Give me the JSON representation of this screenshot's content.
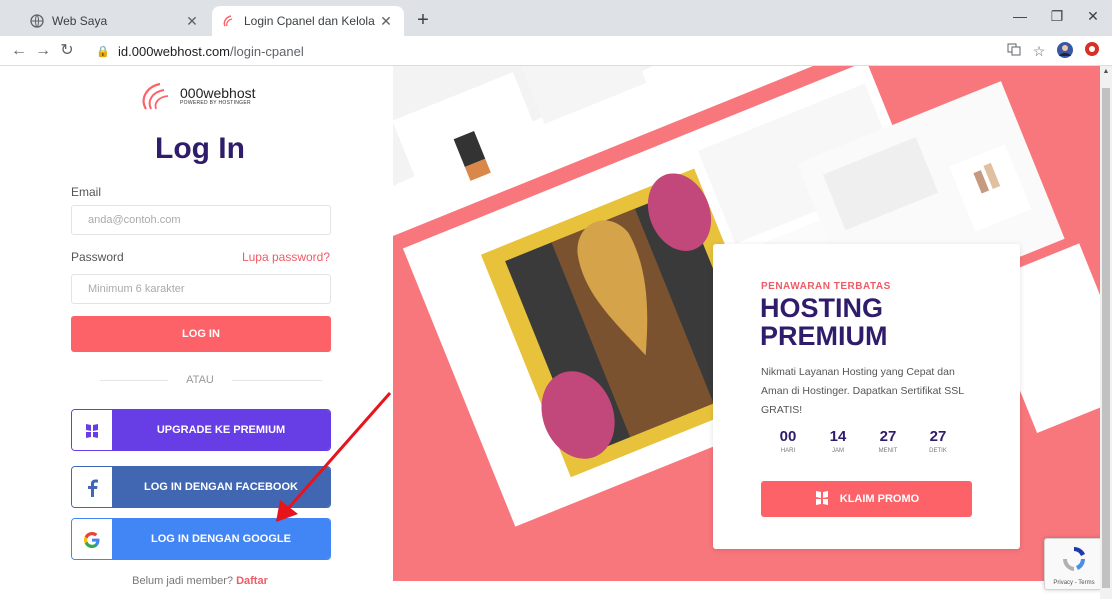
{
  "browser": {
    "tabs": [
      {
        "title": "Web Saya",
        "active": false
      },
      {
        "title": "Login Cpanel dan Kelola Web Ho",
        "active": true
      }
    ],
    "url_host": "id.000webhost.com",
    "url_path": "/login-cpanel"
  },
  "login": {
    "brand": "000webhost",
    "powered_by": "POWERED BY HOSTINGER",
    "heading": "Log In",
    "email_label": "Email",
    "email_placeholder": "anda@contoh.com",
    "password_label": "Password",
    "forgot_link": "Lupa password?",
    "password_placeholder": "Minimum 6 karakter",
    "login_button": "LOG IN",
    "divider_text": "ATAU",
    "premium_button": "UPGRADE KE PREMIUM",
    "facebook_button": "LOG IN DENGAN FACEBOOK",
    "google_button": "LOG IN DENGAN GOOGLE",
    "signup_prompt": "Belum jadi member?",
    "signup_link": "Daftar"
  },
  "promo": {
    "kicker": "PENAWARAN TERBATAS",
    "title_line1": "HOSTING",
    "title_line2": "PREMIUM",
    "description": "Nikmati Layanan Hosting yang Cepat dan Aman di Hostinger. Dapatkan Sertifikat SSL GRATIS!",
    "countdown": [
      {
        "value": "00",
        "unit": "HARI"
      },
      {
        "value": "14",
        "unit": "JAM"
      },
      {
        "value": "27",
        "unit": "MENIT"
      },
      {
        "value": "27",
        "unit": "DETIK"
      }
    ],
    "button": "KLAIM PROMO"
  },
  "recaptcha": {
    "links": "Privacy - Terms"
  },
  "colors": {
    "brand_purple": "#2f1c6a",
    "accent_red": "#fd6268",
    "premium_purple": "#673de6",
    "facebook_blue": "#4267b2",
    "google_blue": "#4285f4",
    "promo_bg_pink": "#f7777d"
  }
}
